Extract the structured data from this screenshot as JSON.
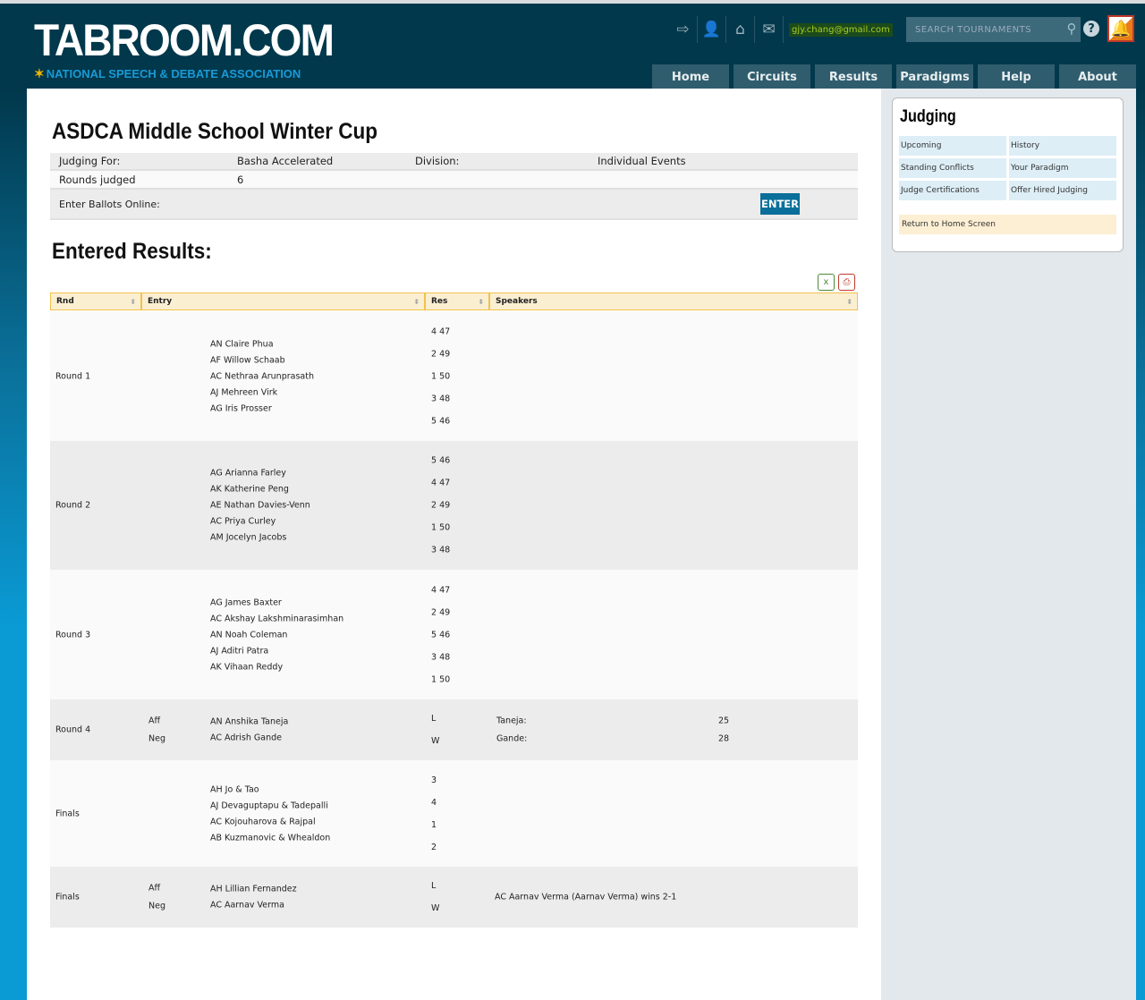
{
  "header": {
    "logo": "TABROOM.COM",
    "tagline": "NATIONAL SPEECH & DEBATE ASSOCIATION",
    "email": "gjy.chang@gmail.com",
    "search_placeholder": "SEARCH  TOURNAMENTS",
    "icons": [
      "logout-icon",
      "user-icon",
      "home-icon",
      "mail-icon"
    ],
    "nav": [
      "Home",
      "Circuits",
      "Results",
      "Paradigms",
      "Help",
      "About"
    ]
  },
  "tournament": {
    "title": "ASDCA Middle School Winter Cup",
    "judging_for_label": "Judging For:",
    "judging_for": "Basha Accelerated",
    "division_label": "Division:",
    "division": "Individual Events",
    "rounds_label": "Rounds judged",
    "rounds": "6",
    "ballots_label": "Enter Ballots Online:",
    "enter_button": "ENTER"
  },
  "results": {
    "title": "Entered Results:",
    "columns": [
      "Rnd",
      "Entry",
      "Res",
      "Speakers"
    ],
    "rows": [
      {
        "rnd": "Round 1",
        "sides": [],
        "entries": [
          "AN Claire Phua",
          "AF Willow Schaab",
          "AC Nethraa Arunprasath",
          "AJ Mehreen Virk",
          "AG Iris Prosser"
        ],
        "results": [
          "4 47",
          "2 49",
          "1 50",
          "3 48",
          "5 46"
        ],
        "speakers": []
      },
      {
        "rnd": "Round 2",
        "sides": [],
        "entries": [
          "AG Arianna Farley",
          "AK Katherine Peng",
          "AE Nathan Davies-Venn",
          "AC Priya Curley",
          "AM Jocelyn Jacobs"
        ],
        "results": [
          "5 46",
          "4 47",
          "2 49",
          "1 50",
          "3 48"
        ],
        "speakers": []
      },
      {
        "rnd": "Round 3",
        "sides": [],
        "entries": [
          "AG James Baxter",
          "AC Akshay Lakshminarasimhan",
          "AN Noah Coleman",
          "AJ Aditri Patra",
          "AK Vihaan Reddy"
        ],
        "results": [
          "4 47",
          "2 49",
          "5 46",
          "3 48",
          "1 50"
        ],
        "speakers": []
      },
      {
        "rnd": "Round 4",
        "sides": [
          "Aff",
          "Neg"
        ],
        "entries": [
          "AN Anshika Taneja",
          "AC Adrish Gande"
        ],
        "results": [
          "L",
          "W"
        ],
        "speakers": [
          {
            "name": "Taneja:",
            "points": "25"
          },
          {
            "name": "Gande:",
            "points": "28"
          }
        ]
      },
      {
        "rnd": "Finals",
        "sides": [],
        "entries": [
          "AH Jo & Tao",
          "AJ Devaguptapu & Tadepalli",
          "AC Kojouharova & Rajpal",
          "AB Kuzmanovic & Whealdon"
        ],
        "results": [
          "3",
          "4",
          "1",
          "2"
        ],
        "speakers": []
      },
      {
        "rnd": "Finals",
        "sides": [
          "Aff",
          "Neg"
        ],
        "entries": [
          "AH Lillian Fernandez",
          "AC Aarnav Verma"
        ],
        "results": [
          "L",
          "W"
        ],
        "speakers": [],
        "note": "AC Aarnav Verma (Aarnav Verma) wins 2-1"
      }
    ]
  },
  "sidebar": {
    "title": "Judging",
    "links": [
      "Upcoming",
      "History",
      "Standing Conflicts",
      "Your Paradigm",
      "Judge Certifications",
      "Offer Hired Judging"
    ],
    "home": "Return to Home Screen"
  }
}
